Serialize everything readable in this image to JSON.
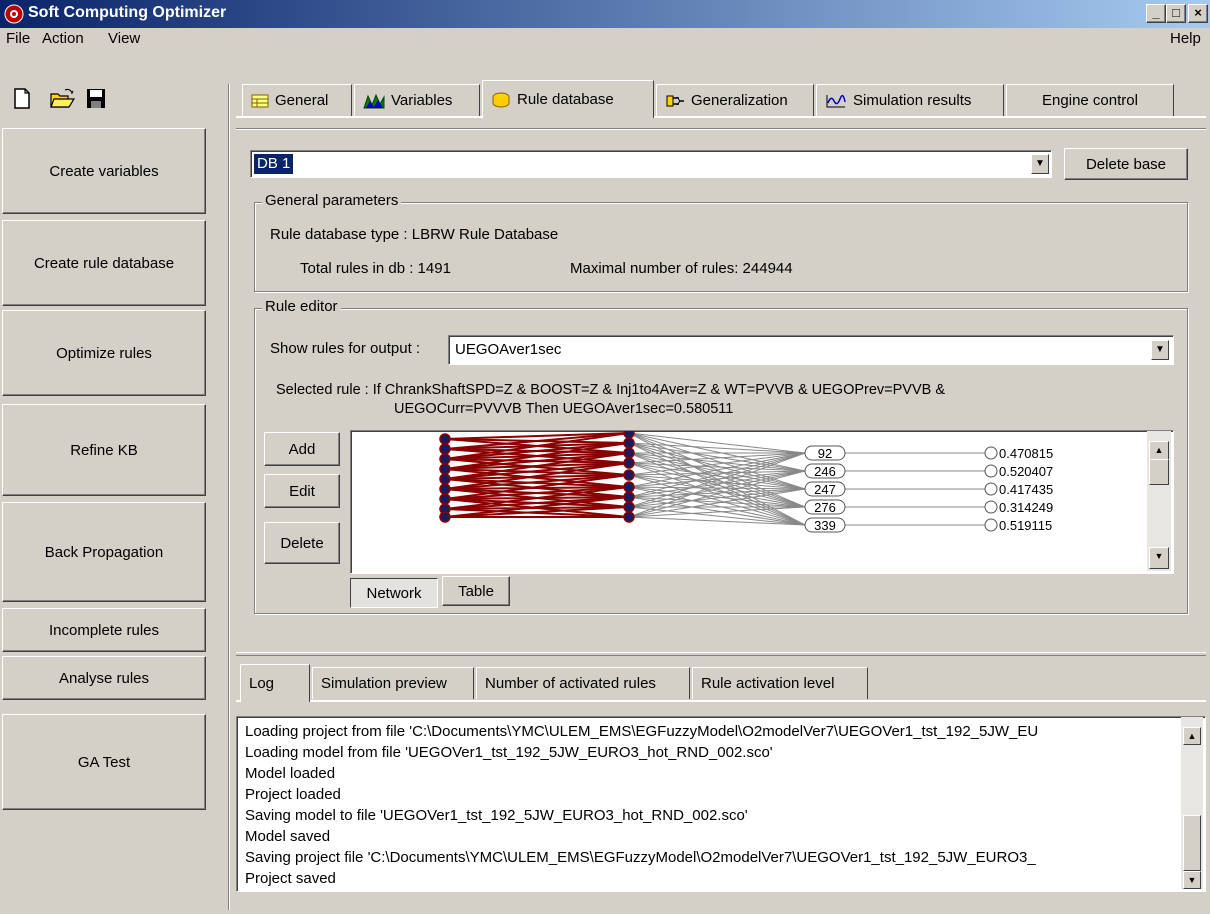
{
  "window": {
    "title": "Soft Computing Optimizer",
    "minimize": "_",
    "maximize": "□",
    "close": "×"
  },
  "menu": {
    "file": "File",
    "action": "Action",
    "view": "View",
    "help": "Help"
  },
  "toolbar_icons": [
    "new-file-icon",
    "open-folder-icon",
    "save-disk-icon"
  ],
  "sidebar": {
    "buttons": [
      "Create variables",
      "Create rule database",
      "Optimize rules",
      "Refine KB",
      "Back Propagation",
      "Incomplete rules",
      "Analyse rules",
      "GA Test"
    ]
  },
  "tabs": [
    {
      "label": "General",
      "icon": "table-icon"
    },
    {
      "label": "Variables",
      "icon": "chart-icon"
    },
    {
      "label": "Rule database",
      "icon": "database-icon",
      "active": true
    },
    {
      "label": "Generalization",
      "icon": "plug-icon"
    },
    {
      "label": "Simulation results",
      "icon": "waveform-icon"
    },
    {
      "label": "Engine control",
      "icon": ""
    }
  ],
  "database": {
    "selected": "DB 1",
    "delete_label": "Delete base"
  },
  "general_params": {
    "title": "General parameters",
    "type_text": "Rule database type : LBRW Rule Database",
    "total_text": "Total rules in db : 1491",
    "max_text": "Maximal number of rules: 244944"
  },
  "rule_editor": {
    "title": "Rule editor",
    "show_label": "Show rules for output :",
    "output_value": "UEGOAver1sec",
    "selected_line1": "Selected rule : If ChrankShaftSPD=Z & BOOST=Z & Inj1to4Aver=Z & WT=PVVB & UEGOPrev=PVVB &",
    "selected_line2": "UEGOCurr=PVVVB Then UEGOAver1sec=0.580511",
    "add": "Add",
    "edit": "Edit",
    "delete": "Delete",
    "view_network": "Network",
    "view_table": "Table",
    "rule_ids": [
      "92",
      "246",
      "247",
      "276",
      "339"
    ],
    "outputs": [
      "0.470815",
      "0.520407",
      "0.417435",
      "0.314249",
      "0.519115"
    ]
  },
  "bottom_tabs": [
    "Log",
    "Simulation preview",
    "Number of activated rules",
    "Rule activation level"
  ],
  "log": [
    "Loading project from file 'C:\\Documents\\YMC\\ULEM_EMS\\EGFuzzyModel\\O2modelVer7\\UEGOVer1_tst_192_5JW_EU",
    "Loading model from file 'UEGOVer1_tst_192_5JW_EURO3_hot_RND_002.sco'",
    "Model loaded",
    "Project loaded",
    "Saving model to file 'UEGOVer1_tst_192_5JW_EURO3_hot_RND_002.sco'",
    "Model saved",
    "Saving project file 'C:\\Documents\\YMC\\ULEM_EMS\\EGFuzzyModel\\O2modelVer7\\UEGOVer1_tst_192_5JW_EURO3_",
    "Project saved"
  ]
}
